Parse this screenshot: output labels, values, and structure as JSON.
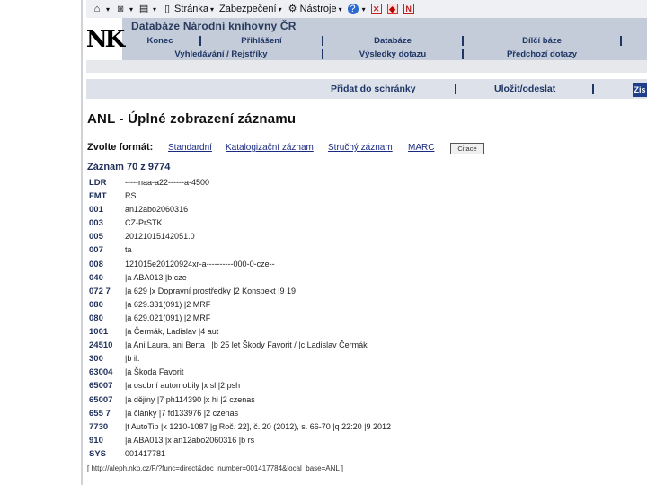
{
  "browser": {
    "menu_page": "Stránka",
    "menu_security": "Zabezpečení",
    "menu_tools": "Nástroje"
  },
  "site": {
    "logo": "NK",
    "title": "Databáze Národní knihovny ČR",
    "nav_row1": [
      "Konec",
      "Přihlášení",
      "Databáze",
      "Dílčí báze"
    ],
    "nav_row2": [
      "Vyhledávání / Rejstříky",
      "Výsledky dotazu",
      "Předchozí dotazy"
    ]
  },
  "actions": {
    "add_to_basket": "Přidat do schránky",
    "save_send": "Uložit/odeslat",
    "send_button": "Zis"
  },
  "page": {
    "title": "ANL - Úplné zobrazení záznamu",
    "format_label": "Zvolte formát:",
    "formats": [
      "Standardní",
      "Katalogizační záznam",
      "Stručný záznam",
      "MARC"
    ],
    "cite_button": "Citace",
    "record_count": "Záznam 70 z 9774",
    "url": "[ http://aleph.nkp.cz/F/?func=direct&doc_number=001417784&local_base=ANL ]"
  },
  "record": [
    {
      "tag": "LDR",
      "value": "-----naa-a22------a-4500"
    },
    {
      "tag": "FMT",
      "value": "RS"
    },
    {
      "tag": "001",
      "value": "an12abo2060316"
    },
    {
      "tag": "003",
      "value": "CZ-PrSTK"
    },
    {
      "tag": "005",
      "value": "20121015142051.0"
    },
    {
      "tag": "007",
      "value": "ta"
    },
    {
      "tag": "008",
      "value": "121015e20120924xr-a----------000-0-cze--"
    },
    {
      "tag": "040",
      "value": "|a ABA013 |b cze"
    },
    {
      "tag": "072 7",
      "value": "|a 629 |x Dopravní prostředky |2 Konspekt |9 19"
    },
    {
      "tag": "080",
      "value": "|a 629.331(091) |2 MRF"
    },
    {
      "tag": "080",
      "value": "|a 629.021(091) |2 MRF"
    },
    {
      "tag": "1001",
      "value": "|a Čermák, Ladislav |4 aut"
    },
    {
      "tag": "24510",
      "value": "|a Ani Laura, ani Berta : |b 25 let Škody Favorit / |c Ladislav Čermák"
    },
    {
      "tag": "300",
      "value": "|b il."
    },
    {
      "tag": "63004",
      "value": "|a Škoda Favorit"
    },
    {
      "tag": "65007",
      "value": "|a osobní automobily |x sl |2 psh"
    },
    {
      "tag": "65007",
      "value": "|a dějiny |7 ph114390 |x hi |2 czenas"
    },
    {
      "tag": "655 7",
      "value": "|a články |7 fd133976 |2 czenas"
    },
    {
      "tag": "7730",
      "value": "|t AutoTip |x 1210-1087 |g Roč. 22], č. 20 (2012), s. 66-70 |q 22:20 |9 2012"
    },
    {
      "tag": "910",
      "value": "|a ABA013 |x an12abo2060316 |b rs"
    },
    {
      "tag": "SYS",
      "value": "001417781"
    }
  ]
}
